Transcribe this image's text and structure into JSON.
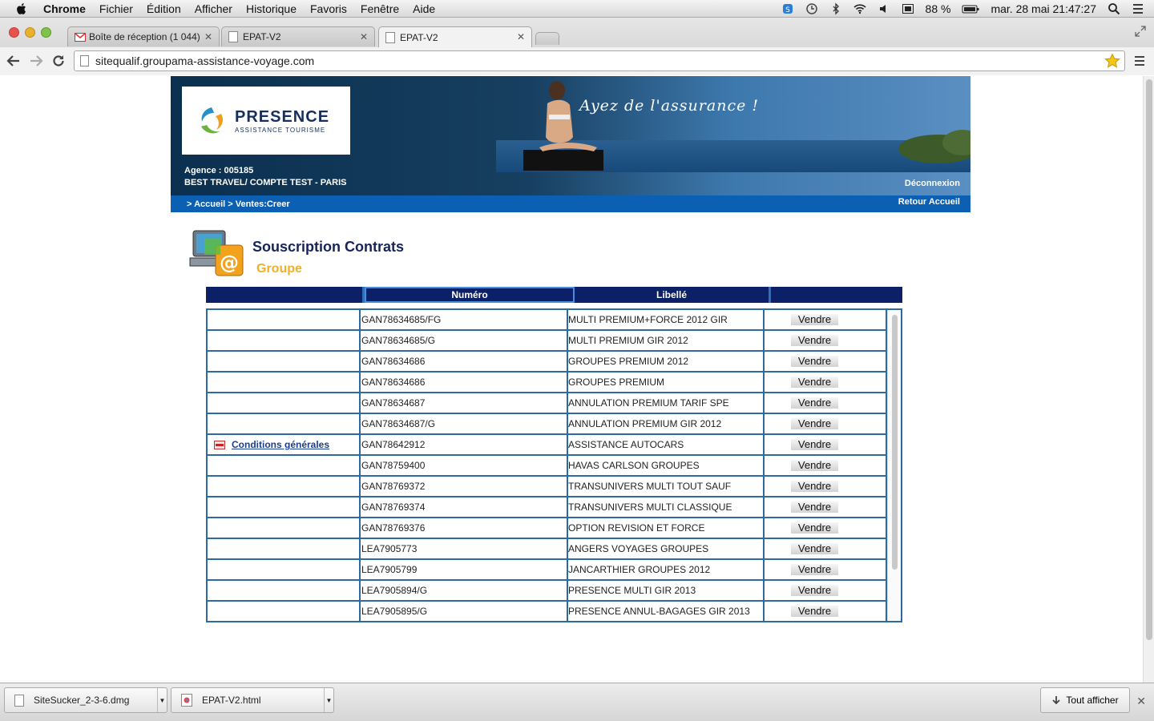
{
  "menubar": {
    "app": "Chrome",
    "items": [
      "Fichier",
      "Édition",
      "Afficher",
      "Historique",
      "Favoris",
      "Fenêtre",
      "Aide"
    ],
    "battery": "88 %",
    "clock": "mar. 28 mai  21:47:27"
  },
  "tabs": [
    {
      "label": "Boîte de réception (1 044)",
      "active": false
    },
    {
      "label": "EPAT-V2",
      "active": false
    },
    {
      "label": "EPAT-V2",
      "active": true
    }
  ],
  "address": {
    "url": "sitequalif.groupama-assistance-voyage.com"
  },
  "banner": {
    "logo_title": "PRESENCE",
    "logo_subtitle": "ASSISTANCE TOURISME",
    "slogan": "Ayez de l'assurance !",
    "agency_label": "Agence :  005185",
    "agency_name": "BEST TRAVEL/ COMPTE TEST - PARIS",
    "logout": "Déconnexion",
    "breadcrumb": "> Accueil > Ventes:Creer",
    "home_link": "Retour Accueil"
  },
  "section": {
    "title": "Souscription Contrats",
    "subtitle": "Groupe"
  },
  "table": {
    "headers": [
      "",
      "Numéro",
      "Libellé",
      ""
    ],
    "conditions_link": "Conditions générales",
    "sell_label": "Vendre",
    "rows": [
      {
        "numero": "GAN78634685/FG",
        "libelle": "MULTI PREMIUM+FORCE 2012 GIR"
      },
      {
        "numero": "GAN78634685/G",
        "libelle": "MULTI PREMIUM GIR 2012"
      },
      {
        "numero": "GAN78634686",
        "libelle": "GROUPES PREMIUM 2012"
      },
      {
        "numero": "GAN78634686",
        "libelle": "GROUPES PREMIUM"
      },
      {
        "numero": "GAN78634687",
        "libelle": "ANNULATION PREMIUM TARIF SPE"
      },
      {
        "numero": "GAN78634687/G",
        "libelle": "ANNULATION PREMIUM GIR 2012"
      },
      {
        "numero": "GAN78642912",
        "libelle": "ASSISTANCE AUTOCARS"
      },
      {
        "numero": "GAN78759400",
        "libelle": "HAVAS CARLSON GROUPES"
      },
      {
        "numero": "GAN78769372",
        "libelle": "TRANSUNIVERS MULTI TOUT SAUF"
      },
      {
        "numero": "GAN78769374",
        "libelle": "TRANSUNIVERS MULTI CLASSIQUE"
      },
      {
        "numero": "GAN78769376",
        "libelle": "OPTION REVISION ET FORCE"
      },
      {
        "numero": "LEA7905773",
        "libelle": "ANGERS VOYAGES GROUPES"
      },
      {
        "numero": "LEA7905799",
        "libelle": "JANCARTHIER GROUPES 2012"
      },
      {
        "numero": "LEA7905894/G",
        "libelle": "PRESENCE MULTI GIR 2013"
      },
      {
        "numero": "LEA7905895/G",
        "libelle": "PRESENCE ANNUL-BAGAGES GIR 2013"
      }
    ]
  },
  "downloads": {
    "items": [
      "SiteSucker_2-3-6.dmg",
      "EPAT-V2.html"
    ],
    "show_all": "Tout afficher"
  },
  "colors": {
    "header_navy": "#0c2068",
    "crumb_blue": "#0b60b4",
    "title_navy": "#16245a",
    "subtitle_gold": "#f0b028",
    "grid_blue": "#2c6aa0"
  }
}
